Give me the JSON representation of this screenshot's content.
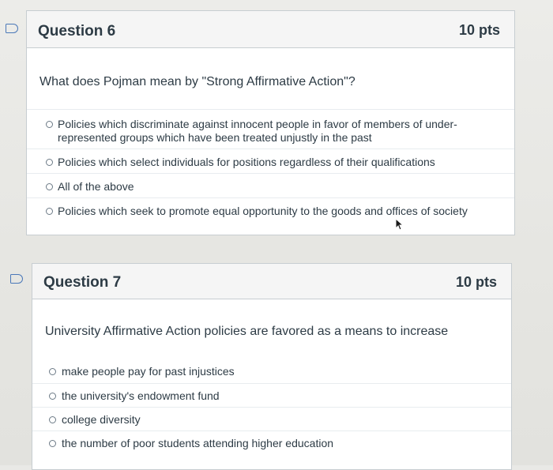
{
  "questions": [
    {
      "title": "Question 6",
      "points": "10 pts",
      "prompt": "What does Pojman mean by \"Strong Affirmative Action\"?",
      "answers": [
        "Policies which discriminate against innocent people in favor of members of under-represented groups which have been treated unjustly in the past",
        "Policies which select individuals for positions regardless of their qualifications",
        "All of the above",
        "Policies which seek to promote equal opportunity to the goods and offices of society"
      ]
    },
    {
      "title": "Question 7",
      "points": "10 pts",
      "prompt": "University Affirmative Action policies are favored as a means to increase",
      "answers": [
        "make people pay for past injustices",
        "the university's endowment fund",
        "college diversity",
        "the number of poor students attending higher education"
      ]
    }
  ],
  "icons": {
    "bookmark": "bookmark-icon",
    "radio": "radio-button-icon",
    "cursor": "mouse-pointer-icon"
  },
  "colors": {
    "accent": "#4a78b8",
    "text": "#2d3b45",
    "header_bg": "#f5f5f5",
    "border": "#c7cdd1"
  }
}
